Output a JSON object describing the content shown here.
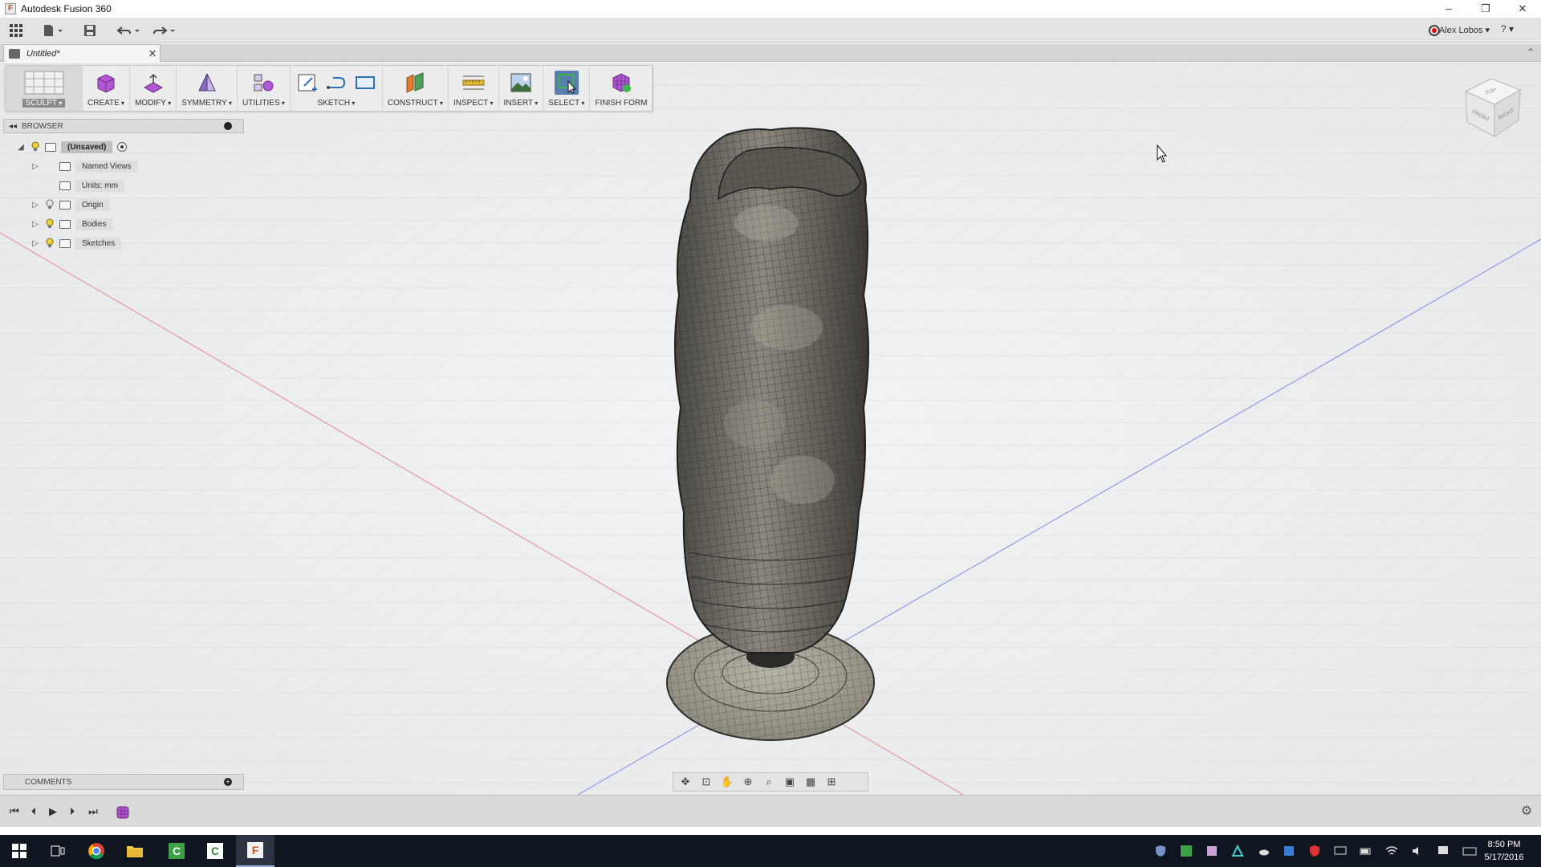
{
  "window": {
    "title": "Autodesk Fusion 360",
    "app_icon_letter": "F",
    "controls": [
      "–",
      "❐",
      "✕"
    ]
  },
  "qab": {
    "user_name": "Alex Lobos ▾",
    "help_label": "? ▾"
  },
  "document_tab": {
    "label": "Untitled*",
    "close": "✕"
  },
  "toolbar": {
    "groups": [
      {
        "label": "SCULPT"
      },
      {
        "label": "CREATE"
      },
      {
        "label": "MODIFY"
      },
      {
        "label": "SYMMETRY"
      },
      {
        "label": "UTILITIES"
      },
      {
        "label": "SKETCH"
      },
      {
        "label": "CONSTRUCT"
      },
      {
        "label": "INSPECT"
      },
      {
        "label": "INSERT"
      },
      {
        "label": "SELECT"
      },
      {
        "label": "FINISH FORM"
      }
    ]
  },
  "browser": {
    "title": "BROWSER",
    "items": [
      {
        "label": "(Unsaved)"
      },
      {
        "label": "Named Views"
      },
      {
        "label": "Units: mm"
      },
      {
        "label": "Origin"
      },
      {
        "label": "Bodies"
      },
      {
        "label": "Sketches"
      }
    ]
  },
  "viewcube": {
    "top": "TOP",
    "front": "FRONT",
    "right": "RIGHT"
  },
  "comments": {
    "title": "COMMENTS"
  },
  "taskbar": {
    "time": "8:50 PM",
    "date": "5/17/2016"
  },
  "colors": {
    "viewport_bg": "#eef0f2",
    "axis_red": "#e07a7a",
    "axis_blue": "#7a8de0",
    "mesh_dark": "#3a3a3a",
    "mesh_light": "#8a857c",
    "taskbar_bg": "#10161f"
  }
}
